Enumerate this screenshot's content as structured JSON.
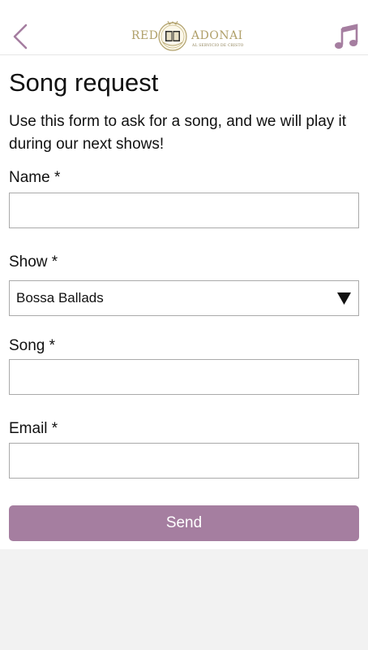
{
  "header": {
    "back_icon": "chevron-left-icon",
    "logo": {
      "left_text": "RED",
      "right_text": "ADONAI",
      "subtitle": "AL SERVICIO DE CRISTO"
    },
    "music_icon": "music-note-icon",
    "accent_color": "#a57ea0",
    "logo_color": "#b0a06a"
  },
  "main": {
    "title": "Song request",
    "intro": "Use this form to ask for a song, and we will play it during our next shows!",
    "fields": {
      "name": {
        "label": "Name *",
        "value": "",
        "placeholder": ""
      },
      "show": {
        "label": "Show *",
        "selected": "Bossa Ballads"
      },
      "song": {
        "label": "Song *",
        "value": "",
        "placeholder": ""
      },
      "email": {
        "label": "Email *",
        "value": "",
        "placeholder": ""
      }
    },
    "send_label": "Send"
  }
}
